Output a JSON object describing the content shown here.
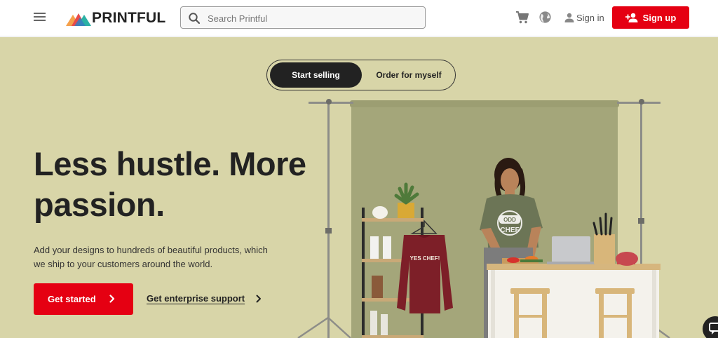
{
  "header": {
    "logo_text": "PRINTFUL",
    "search_placeholder": "Search Printful",
    "signin_label": "Sign in",
    "signup_label": "Sign up",
    "icons": [
      "menu-icon",
      "cart-icon",
      "globe-icon",
      "user-icon",
      "add-user-icon"
    ]
  },
  "hero": {
    "tabs": [
      {
        "label": "Start selling",
        "active": true
      },
      {
        "label": "Order for myself",
        "active": false
      }
    ],
    "headline": "Less hustle. More passion.",
    "subtext": "Add your designs to hundreds of beautiful products, which we ship to your customers around the world.",
    "cta_label": "Get started",
    "enterprise_label": "Get enterprise support",
    "sweatshirt_text": "YES CHEF!",
    "tshirt_text_1": "ODD",
    "tshirt_text_2": "CHEF"
  },
  "colors": {
    "brand_red": "#e50012",
    "hero_bg": "#d8d5a8",
    "backdrop": "#a4a67a",
    "dark": "#222222"
  }
}
